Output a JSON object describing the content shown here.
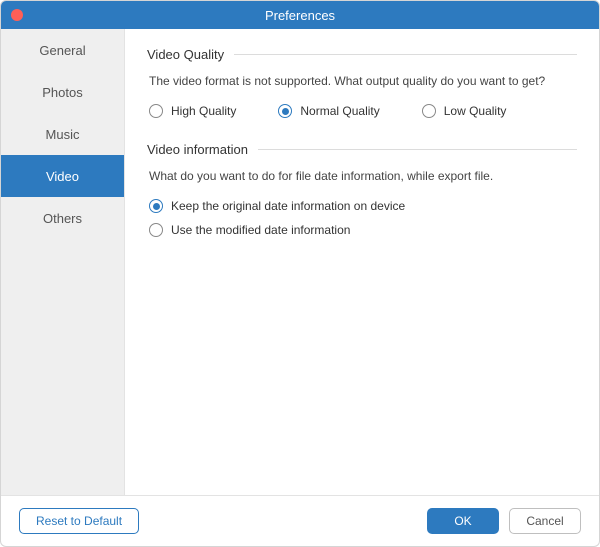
{
  "titlebar": {
    "title": "Preferences"
  },
  "sidebar": {
    "items": [
      {
        "label": "General"
      },
      {
        "label": "Photos"
      },
      {
        "label": "Music"
      },
      {
        "label": "Video"
      },
      {
        "label": "Others"
      }
    ]
  },
  "sections": {
    "videoQuality": {
      "title": "Video Quality",
      "description": "The video format is not supported. What output quality do you want to get?",
      "options": {
        "high": "High Quality",
        "normal": "Normal Quality",
        "low": "Low Quality"
      }
    },
    "videoInformation": {
      "title": "Video information",
      "description": "What do you want to do for file date information, while export file.",
      "options": {
        "keep": "Keep the original date information on device",
        "modified": "Use the modified date information"
      }
    }
  },
  "footer": {
    "reset": "Reset to Default",
    "ok": "OK",
    "cancel": "Cancel"
  }
}
